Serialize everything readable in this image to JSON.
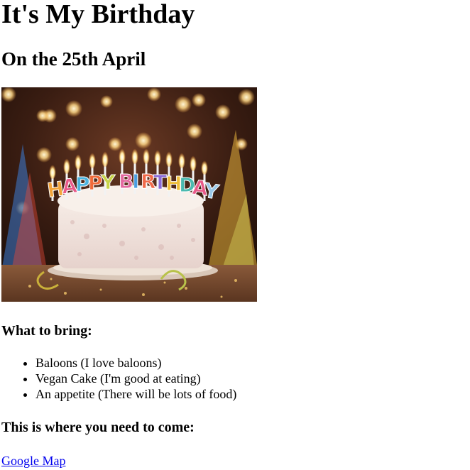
{
  "page": {
    "title": "It's My Birthday",
    "subtitle": "On the 25th April"
  },
  "image": {
    "alt": "Birthday cake with candles",
    "candle_text": "HAPPY BIRTHDAY"
  },
  "bring": {
    "heading": "What to bring:",
    "items": [
      "Baloons (I love baloons)",
      "Vegan Cake (I'm good at eating)",
      "An appetite (There will be lots of food)"
    ]
  },
  "location": {
    "heading": "This is where you need to come:",
    "link_label": "Google Map"
  }
}
